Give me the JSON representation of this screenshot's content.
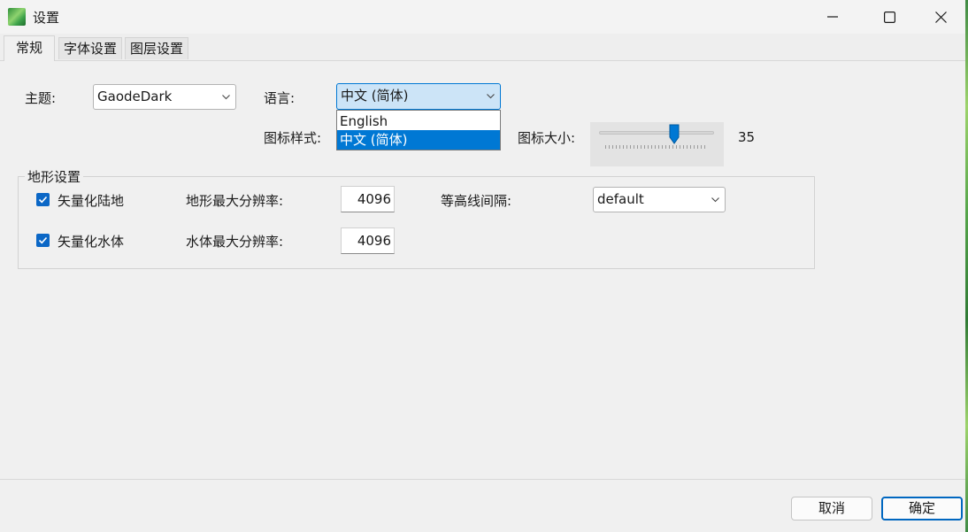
{
  "window": {
    "title": "设置",
    "icon": "app-map-icon",
    "controls": [
      "minimize-icon",
      "maximize-icon",
      "close-icon"
    ]
  },
  "tabs": [
    {
      "label": "常规",
      "active": true
    },
    {
      "label": "字体设置",
      "active": false
    },
    {
      "label": "图层设置",
      "active": false
    }
  ],
  "general": {
    "theme_label": "主题:",
    "theme_value": "GaodeDark",
    "language_label": "语言:",
    "language_value": "中文 (简体)",
    "language_options": [
      "English",
      "中文 (简体)"
    ],
    "language_selected_index": 1,
    "icon_style_label": "图标样式:",
    "icon_size_label": "图标大小:",
    "icon_size_value": "35"
  },
  "terrain": {
    "group_title": "地形设置",
    "vector_land_label": "矢量化陆地",
    "vector_land_checked": true,
    "vector_water_label": "矢量化水体",
    "vector_water_checked": true,
    "land_res_label": "地形最大分辨率:",
    "land_res_value": "4096",
    "water_res_label": "水体最大分辨率:",
    "water_res_value": "4096",
    "contour_label": "等高线间隔:",
    "contour_value": "default"
  },
  "footer": {
    "cancel_label": "取消",
    "ok_label": "确定"
  },
  "colors": {
    "accent": "#0078d4",
    "checkbox": "#0b67c6"
  }
}
